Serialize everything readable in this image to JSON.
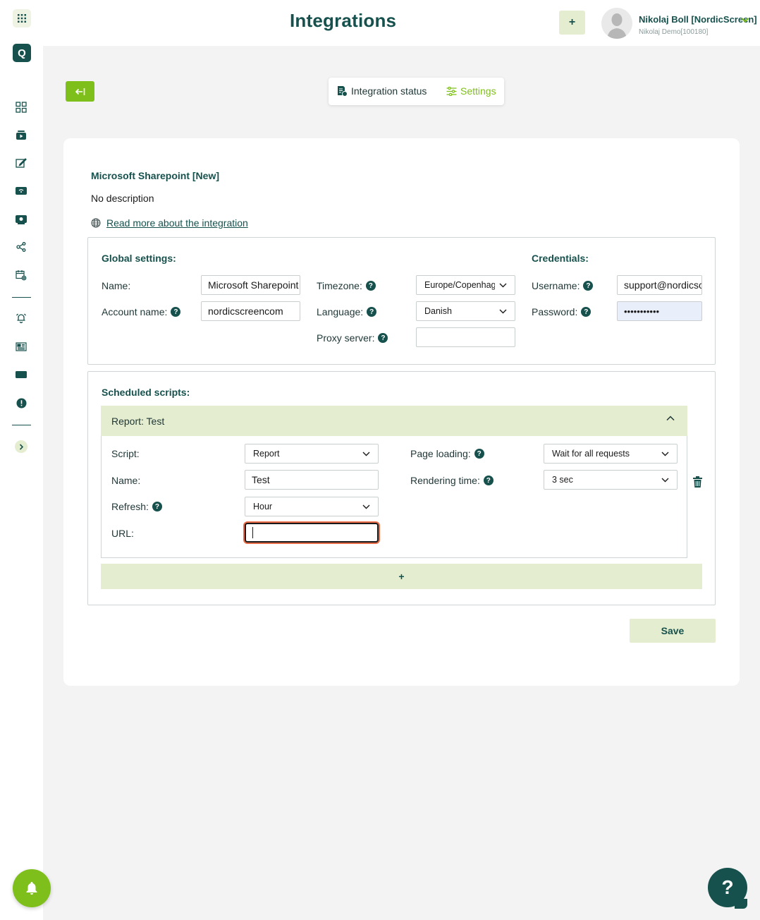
{
  "header": {
    "title": "Integrations",
    "add_label": "+",
    "user_name": "Nikolaj Boll [NordicScreen]",
    "user_sub": "Nikolaj Demo[100180]"
  },
  "sidebar": {
    "logo_letter": "Q",
    "icons": [
      "dashboard-icon",
      "media-icon",
      "edit-icon",
      "screen-wifi-icon",
      "display-icon",
      "share-icon",
      "calendar-settings-icon",
      "alarm-icon",
      "newspaper-icon",
      "card-icon",
      "alert-icon"
    ]
  },
  "tabs": {
    "status_label": "Integration status",
    "settings_label": "Settings"
  },
  "integration": {
    "title": "Microsoft Sharepoint [New]",
    "description": "No description",
    "read_more": "Read more about the integration"
  },
  "global": {
    "heading": "Global settings:",
    "name_label": "Name:",
    "name_value": "Microsoft Sharepoint",
    "account_label": "Account name:",
    "account_value": "nordicscreencom",
    "timezone_label": "Timezone:",
    "timezone_value": "Europe/Copenhagen",
    "language_label": "Language:",
    "language_value": "Danish",
    "proxy_label": "Proxy server:",
    "proxy_value": ""
  },
  "credentials": {
    "heading": "Credentials:",
    "username_label": "Username:",
    "username_value": "support@nordicscreen",
    "password_label": "Password:",
    "password_value": "•••••••••••"
  },
  "scheduled": {
    "heading": "Scheduled scripts:",
    "report_header": "Report: Test",
    "script_label": "Script:",
    "script_value": "Report",
    "name_label": "Name:",
    "name_value": "Test",
    "refresh_label": "Refresh:",
    "refresh_value": "Hour",
    "url_label": "URL:",
    "url_value": "",
    "page_loading_label": "Page loading:",
    "page_loading_value": "Wait for all requests",
    "rendering_label": "Rendering time:",
    "rendering_value": "3 sec",
    "add_label": "+"
  },
  "actions": {
    "save_label": "Save"
  },
  "help_label": "?",
  "colors": {
    "brand_dark": "#16514d",
    "brand_green": "#7fbf1b",
    "light_green": "#e4edcf",
    "focus_ring": "#ea6d4a"
  }
}
